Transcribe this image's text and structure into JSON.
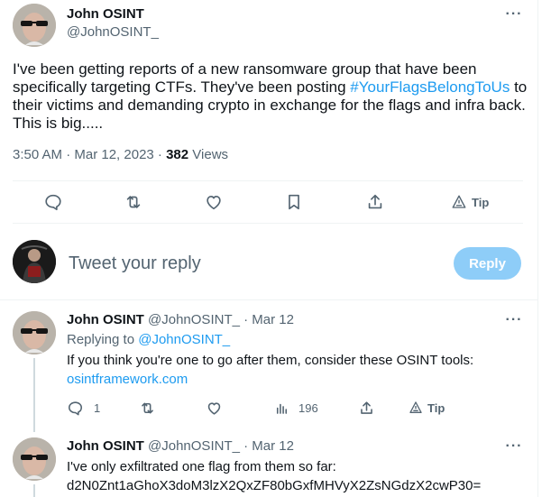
{
  "tweet": {
    "author_name": "John OSINT",
    "author_handle": "@JohnOSINT_",
    "text_before": "I've been getting reports of a new ransomware group that have been specifically targeting CTFs. They've been posting ",
    "hashtag": "#YourFlagsBelongToUs",
    "text_after": " to their victims and demanding crypto in exchange for the flags and infra back. This is big.....",
    "timestamp": "3:50 AM · Mar 12, 2023 · ",
    "views_count": "382",
    "views_label": " Views",
    "tip_label": "Tip"
  },
  "composer": {
    "placeholder": "Tweet your reply",
    "reply_label": "Reply"
  },
  "replies": [
    {
      "author_name": "John OSINT",
      "author_handle": "@JohnOSINT_",
      "date": "Mar 12",
      "replying_prefix": "Replying to ",
      "replying_to": "@JohnOSINT_",
      "text": "If you think you're one to go after them, consider these OSINT tools:",
      "link": "osintframework.com",
      "reply_count": "1",
      "views_count": "196",
      "tip_label": "Tip"
    },
    {
      "author_name": "John OSINT",
      "author_handle": "@JohnOSINT_",
      "date": "Mar 12",
      "text_line1": "I've only exfiltrated one flag from them so far:",
      "text_line2": "d2N0Znt1aGhoX3doM3lzX2QxZF80bGxfMHVyX2ZsNGdzX2cwP30="
    }
  ],
  "icons": {
    "more": "more-dots-icon",
    "reply": "reply-bubble-icon",
    "retweet": "retweet-icon",
    "like": "heart-icon",
    "bookmark": "bookmark-icon",
    "share": "share-icon",
    "tip": "tip-icon",
    "views": "views-bar-icon"
  },
  "colors": {
    "accent": "#1d9bf0",
    "reply_button": "#8ecdf8",
    "secondary_text": "#536471"
  }
}
